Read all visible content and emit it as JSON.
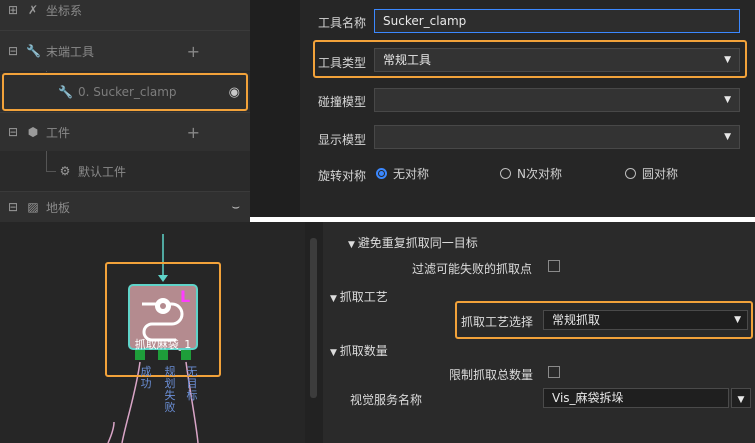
{
  "tree": {
    "items": [
      {
        "label": "坐标系"
      },
      {
        "label": "末端工具"
      },
      {
        "label": "0. Sucker_clamp"
      },
      {
        "label": "工件"
      },
      {
        "label": "默认工件"
      },
      {
        "label": "地板"
      }
    ]
  },
  "props": {
    "tool_name_label": "工具名称",
    "tool_name_value": "Sucker_clamp",
    "tool_type_label": "工具类型",
    "tool_type_value": "常规工具",
    "collision_model_label": "碰撞模型",
    "display_model_label": "显示模型",
    "rotation_sym_label": "旋转对称",
    "radio_options": [
      "无对称",
      "N次对称",
      "圆对称"
    ],
    "radio_selected": "无对称"
  },
  "step": {
    "name": "抓取麻袋_1",
    "outputs": [
      "成功",
      "规划失败",
      "无目标"
    ],
    "ports": [
      "成功",
      "规划失败",
      "无目标"
    ],
    "badge": "L"
  },
  "params": {
    "avoid_repeat_header": "避免重复抓取同一目标",
    "filter_failed_label": "过滤可能失败的抓取点",
    "pick_process_header": "抓取工艺",
    "pick_process_select_label": "抓取工艺选择",
    "pick_process_select_value": "常规抓取",
    "pick_count_header": "抓取数量",
    "limit_total_label": "限制抓取总数量",
    "vision_service_label": "视觉服务名称",
    "vision_service_value": "Vis_麻袋拆垛"
  },
  "colors": {
    "highlight": "#f2a23a",
    "radio_accent": "#3b88ff",
    "node_fill": "#b48b8f",
    "node_border": "#5fd3c9",
    "port": "#1e9e3a",
    "badge": "#ff3dff"
  }
}
